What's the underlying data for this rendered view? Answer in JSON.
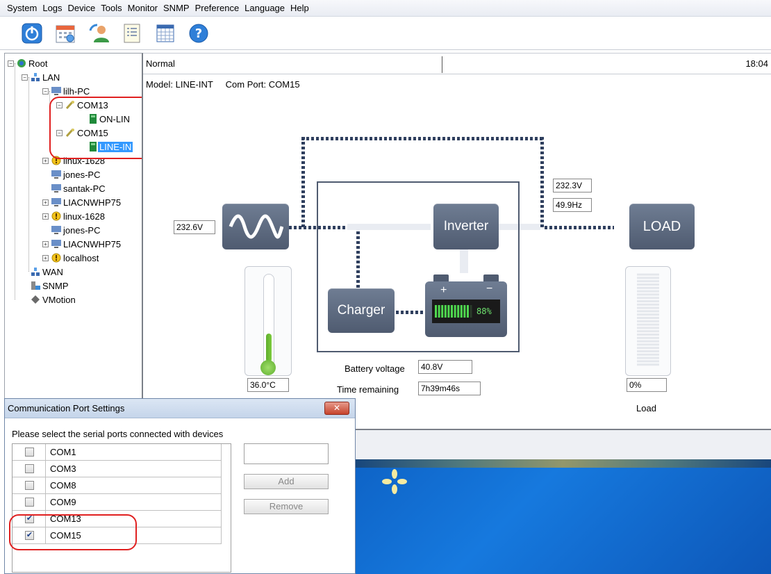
{
  "menu": [
    "System",
    "Logs",
    "Device",
    "Tools",
    "Monitor",
    "SNMP",
    "Preference",
    "Language",
    "Help"
  ],
  "toolbar": {
    "icons": [
      "power-icon",
      "calendar-icon",
      "user-refresh-icon",
      "list-icon",
      "grid-icon",
      "help-icon"
    ],
    "colors": {
      "power": "#2f7fd8",
      "help": "#2f7fd8"
    }
  },
  "tree": {
    "root": "Root",
    "lan": "LAN",
    "pc1": "lilh-PC",
    "com13": "COM13",
    "online": "ON-LIN",
    "com15": "COM15",
    "lineint": "LINE-IN",
    "hosts": [
      "linux-1628",
      "jones-PC",
      "santak-PC",
      "LIACNWHP75",
      "linux-1628",
      "jones-PC",
      "LIACNWHP75",
      "localhost"
    ],
    "wan": "WAN",
    "snmp": "SNMP",
    "vmotion": "VMotion"
  },
  "status": {
    "state": "Normal",
    "time": "18:04"
  },
  "model": {
    "model_text": "Model: LINE-INT",
    "port_text": "Com Port: COM15"
  },
  "ups": {
    "input_voltage": "232.6V",
    "output_voltage": "232.3V",
    "output_freq": "49.9Hz",
    "inverter": "Inverter",
    "load_label_btn": "LOAD",
    "charger": "Charger",
    "battery_pct": "88%",
    "battery_level": 88,
    "battery_voltage_label": "Battery voltage",
    "battery_voltage": "40.8V",
    "time_remaining_label": "Time remaining",
    "time_remaining": "7h39m46s",
    "temperature": "36.0°C",
    "temperature_level": 0.35,
    "load_pct": "0%",
    "load_caption": "Load",
    "load_level": 0
  },
  "dialog": {
    "title": "Communication Port Settings",
    "close": "✕",
    "prompt": "Please select the serial ports connected with devices",
    "ports": [
      {
        "name": "COM1",
        "checked": false
      },
      {
        "name": "COM3",
        "checked": false
      },
      {
        "name": "COM8",
        "checked": false
      },
      {
        "name": "COM9",
        "checked": false
      },
      {
        "name": "COM13",
        "checked": true
      },
      {
        "name": "COM15",
        "checked": true
      }
    ],
    "add": "Add",
    "remove": "Remove"
  }
}
